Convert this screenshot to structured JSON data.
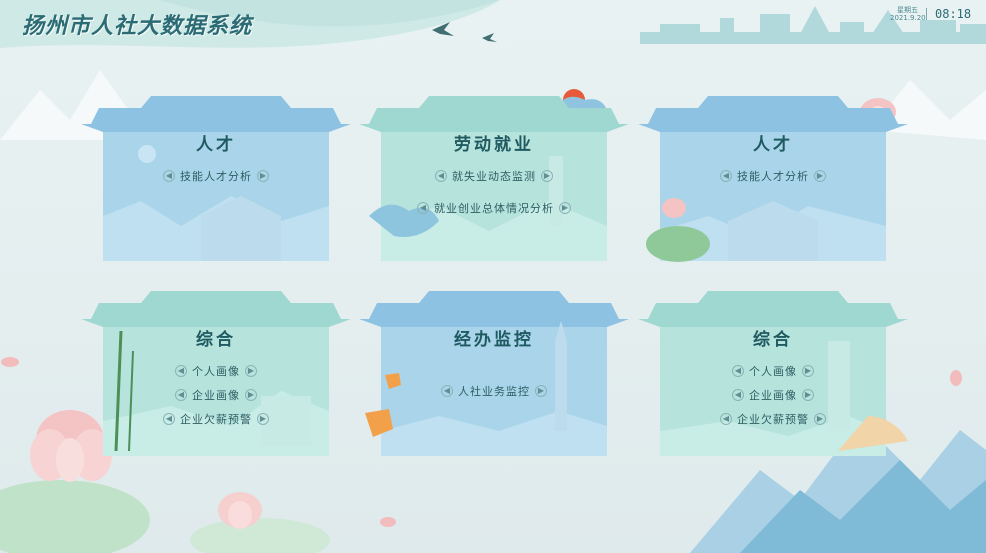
{
  "header": {
    "title": "扬州市人社大数据系统",
    "weekday": "星期五",
    "date": "2021.9.20",
    "time": "08:18"
  },
  "colors": {
    "title_text": "#1f5a61",
    "blue_card": "#9fcde6",
    "teal_card": "#a9dfd8"
  },
  "cards": [
    {
      "title": "人才",
      "theme": "blue",
      "links": [
        "技能人才分析"
      ]
    },
    {
      "title": "劳动就业",
      "theme": "teal",
      "links": [
        "就失业动态监测",
        "就业创业总体情况分析"
      ]
    },
    {
      "title": "人才",
      "theme": "blue",
      "links": [
        "技能人才分析"
      ]
    },
    {
      "title": "综合",
      "theme": "teal",
      "links": [
        "个人画像",
        "企业画像",
        "企业欠薪预警"
      ]
    },
    {
      "title": "经办监控",
      "theme": "blue",
      "links": [
        "人社业务监控"
      ]
    },
    {
      "title": "综合",
      "theme": "teal",
      "links": [
        "个人画像",
        "企业画像",
        "企业欠薪预警"
      ]
    }
  ]
}
